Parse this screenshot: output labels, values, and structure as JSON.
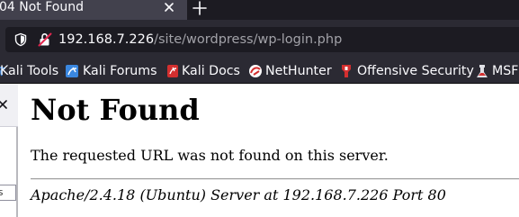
{
  "tab": {
    "title": "04 Not Found"
  },
  "urlbar": {
    "host": "192.168.7.226",
    "path": "/site/wordpress/wp-login.php"
  },
  "bookmarks": [
    {
      "label": "Kali Tools",
      "icon": "kali-dragon-icon"
    },
    {
      "label": "Kali Forums",
      "icon": "kali-forums-icon"
    },
    {
      "label": "Kali Docs",
      "icon": "kali-docs-icon"
    },
    {
      "label": "NetHunter",
      "icon": "nethunter-icon"
    },
    {
      "label": "Offensive Security",
      "icon": "offsec-icon"
    },
    {
      "label": "MSF",
      "icon": "msf-icon"
    }
  ],
  "sidebar": {
    "input_text": "ss"
  },
  "page": {
    "heading": "Not Found",
    "message": "The requested URL was not found on this server.",
    "address": "Apache/2.4.18 (Ubuntu) Server at 192.168.7.226 Port 80"
  },
  "colors": {
    "tab_strip": "#1c1b22",
    "active_tab": "#42414d",
    "toolbar": "#2b2a33",
    "urlbar_field": "#1c1b22",
    "insecure_red": "#e22850"
  }
}
